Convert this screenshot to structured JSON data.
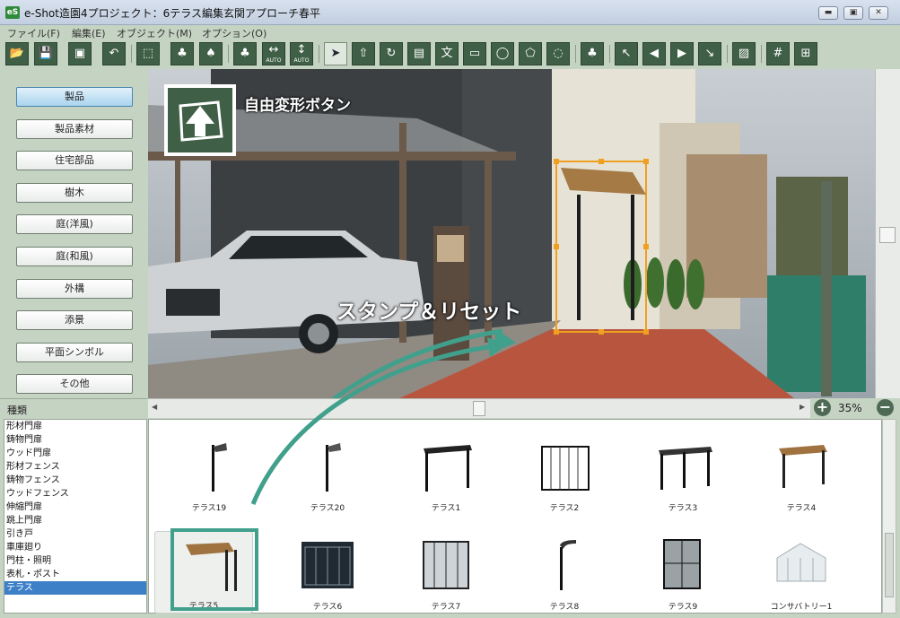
{
  "window": {
    "title": "e-Shot造園4プロジェクト：6テラス編集玄関アプローチ春平",
    "icon_text": "eS",
    "controls": [
      "minimize",
      "maximize",
      "close"
    ]
  },
  "menu": [
    "ファイル(F)",
    "編集(E)",
    "オブジェクト(M)",
    "オプション(O)"
  ],
  "toolbar": {
    "auto_label": "AUTO",
    "buttons": [
      {
        "name": "open-icon",
        "glyph": "📂"
      },
      {
        "name": "save-icon",
        "glyph": "💾"
      },
      {
        "name": "photo-icon",
        "glyph": "▣"
      },
      {
        "name": "undo-icon",
        "glyph": "↶"
      },
      {
        "name": "paste-icon",
        "glyph": "⬚"
      },
      {
        "name": "trees-icon",
        "glyph": "♣"
      },
      {
        "name": "tree-import-icon",
        "glyph": "♠"
      },
      {
        "name": "forest-icon",
        "glyph": "♣"
      },
      {
        "name": "auto-horizontal-icon",
        "glyph": "↔"
      },
      {
        "name": "auto-vertical-icon",
        "glyph": "↕"
      },
      {
        "name": "select-arrow-icon",
        "glyph": "➤"
      },
      {
        "name": "free-transform-icon",
        "glyph": "⇧"
      },
      {
        "name": "rotate-icon",
        "glyph": "↻"
      },
      {
        "name": "image-icon",
        "glyph": "▤"
      },
      {
        "name": "text-icon",
        "glyph": "文"
      },
      {
        "name": "rect-select-icon",
        "glyph": "▭"
      },
      {
        "name": "ellipse-select-icon",
        "glyph": "◯"
      },
      {
        "name": "polygon-select-icon",
        "glyph": "⬠"
      },
      {
        "name": "lasso-icon",
        "glyph": "◌"
      },
      {
        "name": "tree-group-icon",
        "glyph": "♣"
      },
      {
        "name": "move-up-left-icon",
        "glyph": "↖"
      },
      {
        "name": "move-left-icon",
        "glyph": "◀"
      },
      {
        "name": "move-right-icon",
        "glyph": "▶"
      },
      {
        "name": "move-down-right-icon",
        "glyph": "↘"
      },
      {
        "name": "hatch-icon",
        "glyph": "▨"
      },
      {
        "name": "grid-icon",
        "glyph": "#"
      },
      {
        "name": "grid-settings-icon",
        "glyph": "⊞"
      }
    ]
  },
  "categories": [
    {
      "label": "製品",
      "active": true
    },
    {
      "label": "製品素材",
      "active": false
    },
    {
      "label": "住宅部品",
      "active": false
    },
    {
      "label": "樹木",
      "active": false
    },
    {
      "label": "庭(洋風)",
      "active": false
    },
    {
      "label": "庭(和風)",
      "active": false
    },
    {
      "label": "外構",
      "active": false
    },
    {
      "label": "添景",
      "active": false
    },
    {
      "label": "平面シンボル",
      "active": false
    },
    {
      "label": "その他",
      "active": false
    }
  ],
  "annotations": {
    "free_transform": "自由変形ボタン",
    "stamp_reset": "スタンプ＆リセット"
  },
  "zoom": {
    "value": "35%",
    "plus": "+",
    "minus": "−"
  },
  "type_panel": {
    "header": "種類",
    "items": [
      "形材門扉",
      "鋳物門扉",
      "ウッド門扉",
      "形材フェンス",
      "鋳物フェンス",
      "ウッドフェンス",
      "伸縮門扉",
      "跳上門扉",
      "引き戸",
      "車庫廻り",
      "門柱・照明",
      "表札・ポスト",
      "テラス"
    ],
    "selected_index": 12
  },
  "products": [
    {
      "label": "テラス19",
      "kind": "post"
    },
    {
      "label": "テラス20",
      "kind": "post"
    },
    {
      "label": "テラス1",
      "kind": "pergola"
    },
    {
      "label": "テラス2",
      "kind": "enclosure"
    },
    {
      "label": "テラス3",
      "kind": "pergola"
    },
    {
      "label": "テラス4",
      "kind": "wood"
    },
    {
      "label": "テラス5",
      "kind": "wood"
    },
    {
      "label": "テラス6",
      "kind": "enclosure"
    },
    {
      "label": "テラス7",
      "kind": "enclosure"
    },
    {
      "label": "テラス8",
      "kind": "post"
    },
    {
      "label": "テラス9",
      "kind": "enclosure"
    },
    {
      "label": "コンサバトリー1",
      "kind": "conservatory"
    }
  ],
  "colors": {
    "panel_green": "#c5d3c2",
    "toolbar_button": "#3f5f46",
    "highlight_teal": "#41a08c",
    "selection_orange": "#f0a020",
    "list_selection": "#3e80c8"
  }
}
